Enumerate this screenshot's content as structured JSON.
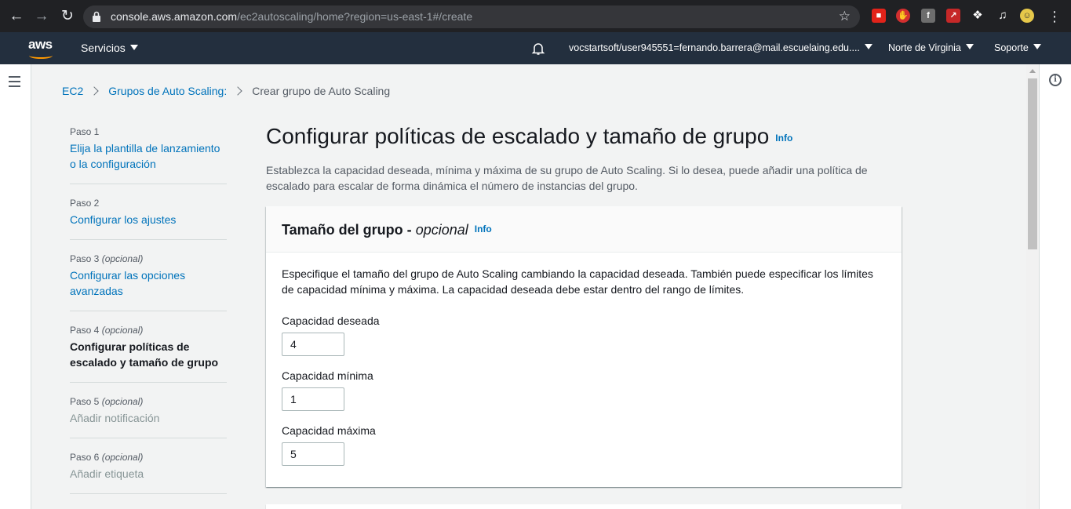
{
  "browser": {
    "url_host": "console.aws.amazon.com",
    "url_path": "/ec2autoscaling/home?region=us-east-1#/create",
    "extensions": [
      "roblox-icon",
      "adblock-icon",
      "facebook-icon",
      "chart-icon",
      "puzzle-icon",
      "media-icon",
      "avatar-icon"
    ]
  },
  "header": {
    "logo": "aws",
    "services": "Servicios",
    "account": "vocstartsoft/user945551=fernando.barrera@mail.escuelaing.edu....",
    "region": "Norte de Virginia",
    "support": "Soporte"
  },
  "breadcrumb": {
    "items": [
      "EC2",
      "Grupos de Auto Scaling:"
    ],
    "current": "Crear grupo de Auto Scaling"
  },
  "steps": [
    {
      "num": "Paso 1",
      "optional": "",
      "title": "Elija la plantilla de lanzamiento o la configuración",
      "state": "link"
    },
    {
      "num": "Paso 2",
      "optional": "",
      "title": "Configurar los ajustes",
      "state": "link"
    },
    {
      "num": "Paso 3",
      "optional": "(opcional)",
      "title": "Configurar las opciones avanzadas",
      "state": "link"
    },
    {
      "num": "Paso 4",
      "optional": "(opcional)",
      "title": "Configurar políticas de escalado y tamaño de grupo",
      "state": "active"
    },
    {
      "num": "Paso 5",
      "optional": "(opcional)",
      "title": "Añadir notificación",
      "state": "disabled"
    },
    {
      "num": "Paso 6",
      "optional": "(opcional)",
      "title": "Añadir etiqueta",
      "state": "disabled"
    }
  ],
  "main": {
    "title": "Configurar políticas de escalado y tamaño de grupo",
    "info": "Info",
    "description": "Establezca la capacidad deseada, mínima y máxima de su grupo de Auto Scaling. Si lo desea, puede añadir una política de escalado para escalar de forma dinámica el número de instancias del grupo."
  },
  "group_size": {
    "title": "Tamaño del grupo -",
    "title_optional": "opcional",
    "info": "Info",
    "description": "Especifique el tamaño del grupo de Auto Scaling cambiando la capacidad deseada. También puede especificar los límites de capacidad mínima y máxima. La capacidad deseada debe estar dentro del rango de límites.",
    "desired_label": "Capacidad deseada",
    "desired_value": "4",
    "min_label": "Capacidad mínima",
    "min_value": "1",
    "max_label": "Capacidad máxima",
    "max_value": "5"
  }
}
